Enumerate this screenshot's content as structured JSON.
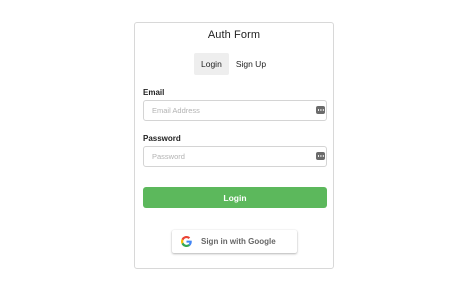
{
  "form": {
    "title": "Auth Form",
    "tabs": [
      {
        "label": "Login",
        "active": true
      },
      {
        "label": "Sign Up",
        "active": false
      }
    ],
    "email": {
      "label": "Email",
      "placeholder": "Email Address",
      "value": ""
    },
    "password": {
      "label": "Password",
      "placeholder": "Password",
      "value": ""
    },
    "submit_label": "Login",
    "google_label": "Sign in with Google"
  },
  "icons": {
    "autofill": "password-manager-key-icon",
    "google": "google-g-icon"
  },
  "colors": {
    "primary": "#5cb85c",
    "tab_active_bg": "#eeeeee",
    "border": "#d8d8d8"
  }
}
